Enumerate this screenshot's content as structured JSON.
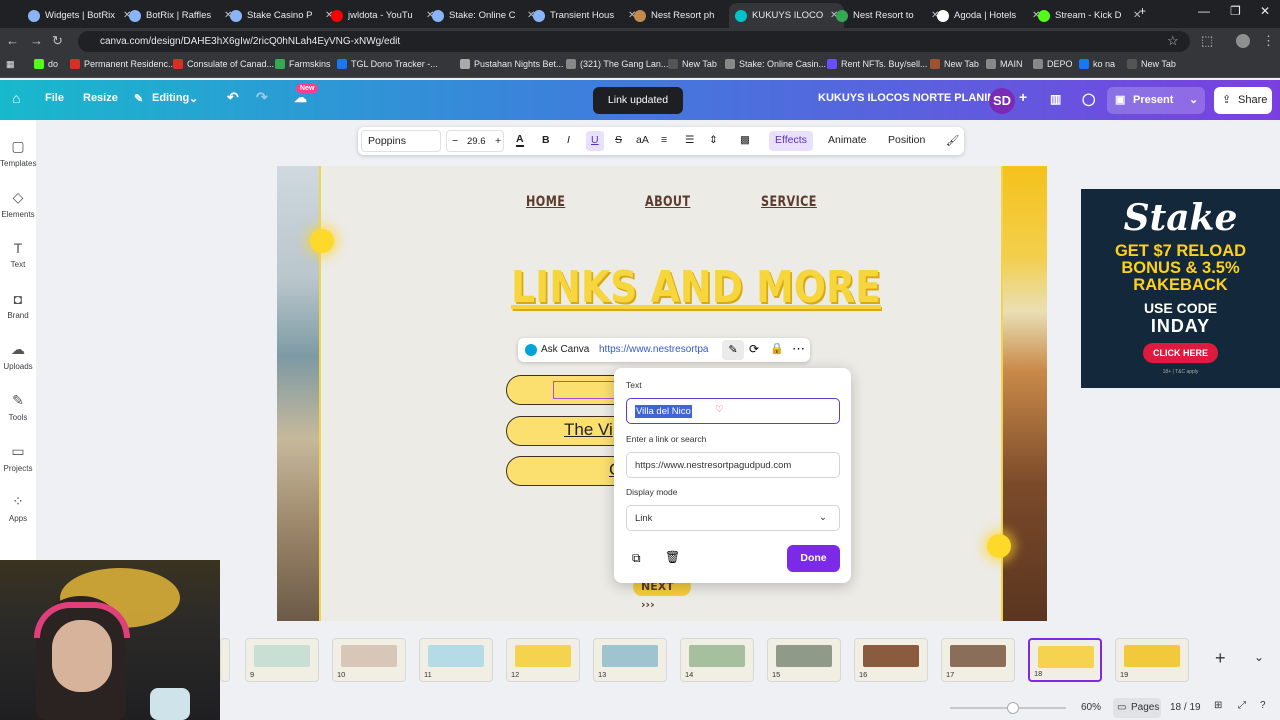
{
  "browser": {
    "tabs": [
      {
        "title": "Widgets | BotRix",
        "active": false
      },
      {
        "title": "BotRix | Raffles",
        "active": false
      },
      {
        "title": "Stake Casino P",
        "active": false
      },
      {
        "title": "jwldota - YouTu",
        "active": false
      },
      {
        "title": "Stake: Online C",
        "active": false
      },
      {
        "title": "Transient Hous",
        "active": false
      },
      {
        "title": "Nest Resort ph",
        "active": false
      },
      {
        "title": "KUKUYS ILOCO",
        "active": true
      },
      {
        "title": "Nest Resort to",
        "active": false
      },
      {
        "title": "Agoda | Hotels",
        "active": false
      },
      {
        "title": "Stream - Kick D",
        "active": false
      }
    ],
    "url": "canva.com/design/DAHE3hX6gIw/2ricQ0hNLah4EyVNG-xNWg/edit",
    "bookmarks": [
      "do",
      "Permanent Residenc...",
      "Consulate of Canad...",
      "Farmskins",
      "TGL Dono Tracker -...",
      "Pustahan Nights Bet...",
      "(321) The Gang Lan...",
      "New Tab",
      "Stake: Online Casin...",
      "Rent NFTs. Buy/sell...",
      "New Tab",
      "MAIN",
      "DEPO",
      "ko na",
      "New Tab"
    ]
  },
  "header": {
    "file": "File",
    "resize": "Resize",
    "editing": "Editing",
    "new_badge": "New",
    "toast": "Link updated",
    "project_title": "KUKUYS ILOCOS NORTE PLANING",
    "avatar": "SD",
    "present": "Present",
    "share": "Share"
  },
  "rail": [
    "Templates",
    "Elements",
    "Text",
    "Brand",
    "Uploads",
    "Tools",
    "Projects",
    "Apps"
  ],
  "toolbar": {
    "font": "Poppins",
    "size": "29.6",
    "effects": "Effects",
    "animate": "Animate",
    "position": "Position"
  },
  "slide": {
    "nav": [
      "HOME",
      "ABOUT",
      "SERVICE"
    ],
    "title": "LINKS AND MORE",
    "pill2_text": "The Vi",
    "pill3_text": "C",
    "next": "NEXT"
  },
  "linkbar": {
    "ask": "Ask Canva",
    "url": "https://www.nestresortpa"
  },
  "popover": {
    "text_label": "Text",
    "text_value": "Villa del Nico",
    "link_label": "Enter a link or search",
    "link_value": "https://www.nestresortpagudpud.com",
    "display_label": "Display mode",
    "display_value": "Link",
    "done": "Done"
  },
  "ad": {
    "brand": "Stake",
    "line1": "GET $7 RELOAD",
    "line2": "BONUS & 3.5%",
    "line3": "RAKEBACK",
    "code_label": "USE CODE",
    "code": "INDAY",
    "cta": "CLICK HERE",
    "fine": "18+ | T&C apply"
  },
  "thumbnails": [
    "9",
    "10",
    "11",
    "12",
    "13",
    "14",
    "15",
    "16",
    "17",
    "18",
    "19"
  ],
  "footer": {
    "zoom": "60%",
    "pages_label": "Pages",
    "page_count": "18 / 19"
  }
}
